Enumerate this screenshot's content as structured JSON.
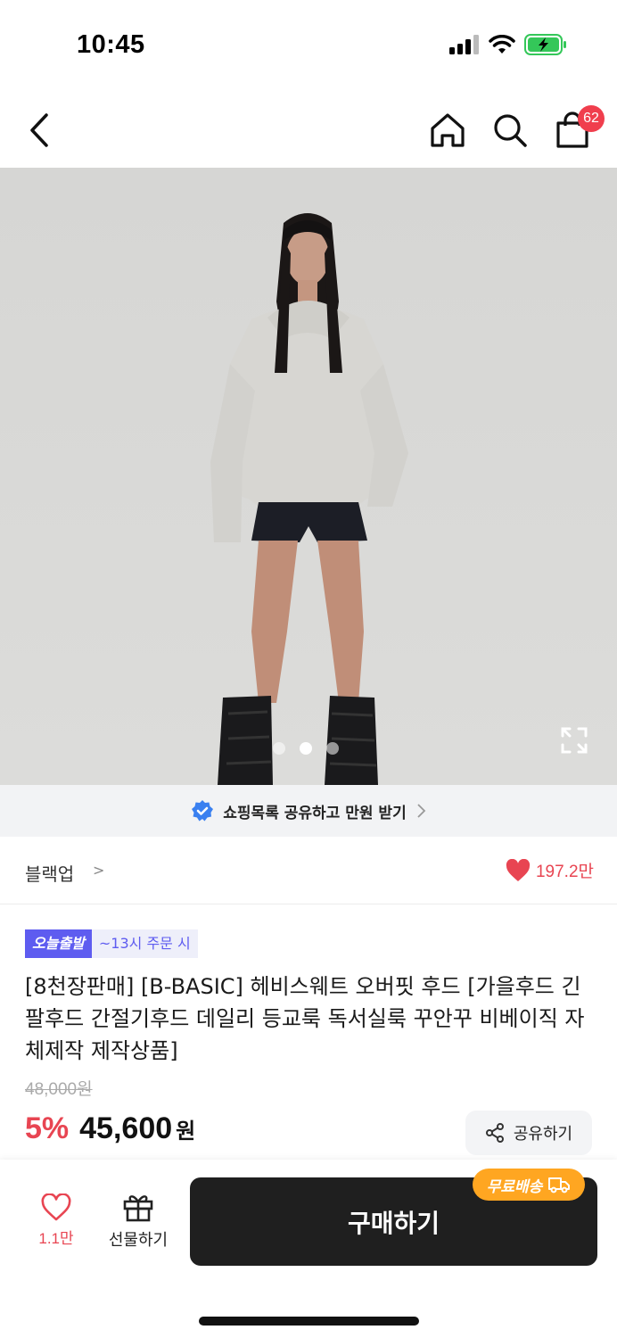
{
  "status_bar": {
    "time": "10:45"
  },
  "nav": {
    "back_icon": "chevron-left-icon",
    "home_icon": "home-icon",
    "search_icon": "search-icon",
    "cart_icon": "shopping-bag-icon",
    "cart_badge": "62"
  },
  "gallery": {
    "image_count": 3,
    "active_index": 1,
    "expand_icon": "expand-icon"
  },
  "share_banner": {
    "text": "쇼핑목록 공유하고 만원 받기",
    "icon": "verified-check-icon"
  },
  "brand": {
    "name": "블랙업",
    "chevron": ">",
    "like_count": "197.2만",
    "like_icon": "heart-filled-icon"
  },
  "badges": {
    "today_ship": "오늘출발",
    "order_cutoff": "~13시 주문 시"
  },
  "product": {
    "title": "[8천장판매] [B-BASIC] 헤비스웨트 오버핏 후드 [가을후드 긴팔후드 간절기후드 데일리 등교룩 독서실룩 꾸안꾸 비베이직 자체제작 제작상품]",
    "original_price": "48,000원",
    "discount": "5%",
    "price": "45,600",
    "price_unit": "원"
  },
  "share_button": {
    "label": "공유하기",
    "icon": "share-icon"
  },
  "bottom_bar": {
    "wish_count": "1.1만",
    "wish_icon": "heart-outline-icon",
    "gift_label": "선물하기",
    "gift_icon": "gift-icon",
    "buy_label": "구매하기",
    "free_shipping": "무료배송",
    "truck_icon": "truck-icon"
  },
  "colors": {
    "accent_red": "#e84552",
    "badge_purple": "#5e5cf0",
    "free_ship_orange": "#ffa621",
    "buy_button": "#1f1f1f"
  }
}
